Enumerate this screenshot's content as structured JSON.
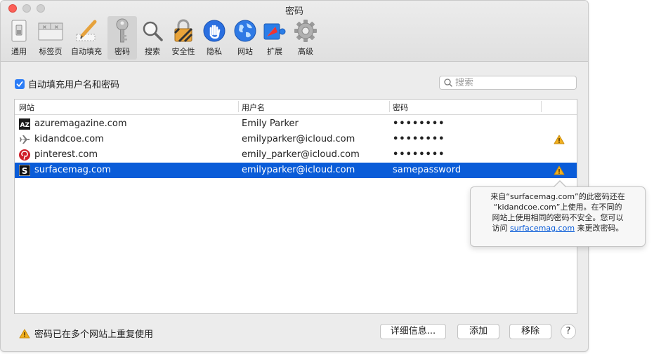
{
  "window": {
    "title": "密码"
  },
  "toolbar": {
    "items": [
      {
        "label": "通用",
        "icon": "switch-icon"
      },
      {
        "label": "标签页",
        "icon": "tabs-icon"
      },
      {
        "label": "自动填充",
        "icon": "pencil-icon"
      },
      {
        "label": "密码",
        "icon": "key-icon",
        "active": true
      },
      {
        "label": "搜索",
        "icon": "magnifier-icon"
      },
      {
        "label": "安全性",
        "icon": "lock-icon"
      },
      {
        "label": "隐私",
        "icon": "hand-icon"
      },
      {
        "label": "网站",
        "icon": "globe-icon"
      },
      {
        "label": "扩展",
        "icon": "puzzle-icon"
      },
      {
        "label": "高级",
        "icon": "gear-icon"
      }
    ]
  },
  "autofill": {
    "label": "自动填充用户名和密码",
    "checked": true
  },
  "search": {
    "placeholder": "搜索",
    "value": ""
  },
  "table": {
    "headers": {
      "website": "网站",
      "username": "用户名",
      "password": "密码"
    },
    "rows": [
      {
        "site": "azuremagazine.com",
        "icon": "az-icon",
        "user": "Emily Parker",
        "pass": "••••••••",
        "warning": false,
        "selected": false
      },
      {
        "site": "kidandcoe.com",
        "icon": "plane-icon",
        "user": "emilyparker@icloud.com",
        "pass": "••••••••",
        "warning": true,
        "selected": false
      },
      {
        "site": "pinterest.com",
        "icon": "pinterest-icon",
        "user": "emily_parker@icloud.com",
        "pass": "••••••••",
        "warning": false,
        "selected": false
      },
      {
        "site": "surfacemag.com",
        "icon": "surface-s-icon",
        "user": "emilyparker@icloud.com",
        "pass": "samepassword",
        "warning": true,
        "selected": true
      }
    ]
  },
  "tooltip": {
    "line1": "来自“surfacemag.com”的此密码还在",
    "line2": "“kidandcoe.com”上使用。在不同的",
    "line3": "网站上使用相同的密码不安全。您可以",
    "line4_prefix": "访问 ",
    "link": "surfacemag.com",
    "line4_suffix": " 来更改密码。"
  },
  "footer": {
    "warning_text": "密码已在多个网站上重复使用",
    "details_label": "详细信息...",
    "add_label": "添加",
    "remove_label": "移除",
    "help_label": "?"
  },
  "colors": {
    "accent": "#0a5cd8",
    "warning": "#f2b01e",
    "close": "#fc5f57"
  }
}
